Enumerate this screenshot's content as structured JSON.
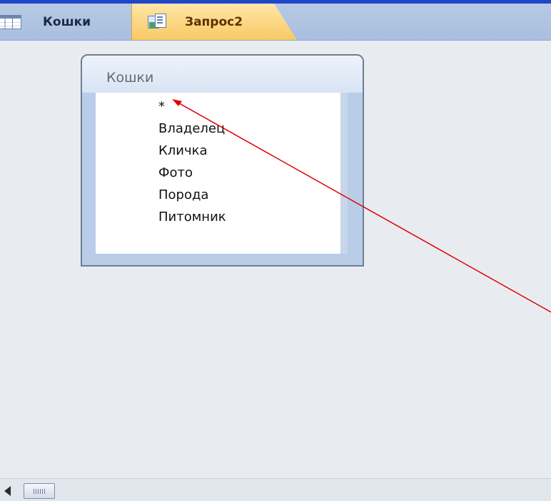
{
  "tabs": [
    {
      "label": "Кошки",
      "icon": "table-icon",
      "active": false
    },
    {
      "label": "Запрос2",
      "icon": "query-icon",
      "active": true
    }
  ],
  "field_list": {
    "title": "Кошки",
    "fields": [
      "*",
      "Владелец",
      "Кличка",
      "Фото",
      "Порода",
      "Питомник"
    ]
  },
  "colors": {
    "annotation_arrow": "#e00000",
    "active_tab": "#f9c964",
    "tab_bar": "#b7c9e4",
    "workspace": "#e8ecf1"
  },
  "scrollbar": {
    "left_icon": "scroll-left-icon",
    "thumb_icon": "scroll-thumb-grip-icon"
  }
}
